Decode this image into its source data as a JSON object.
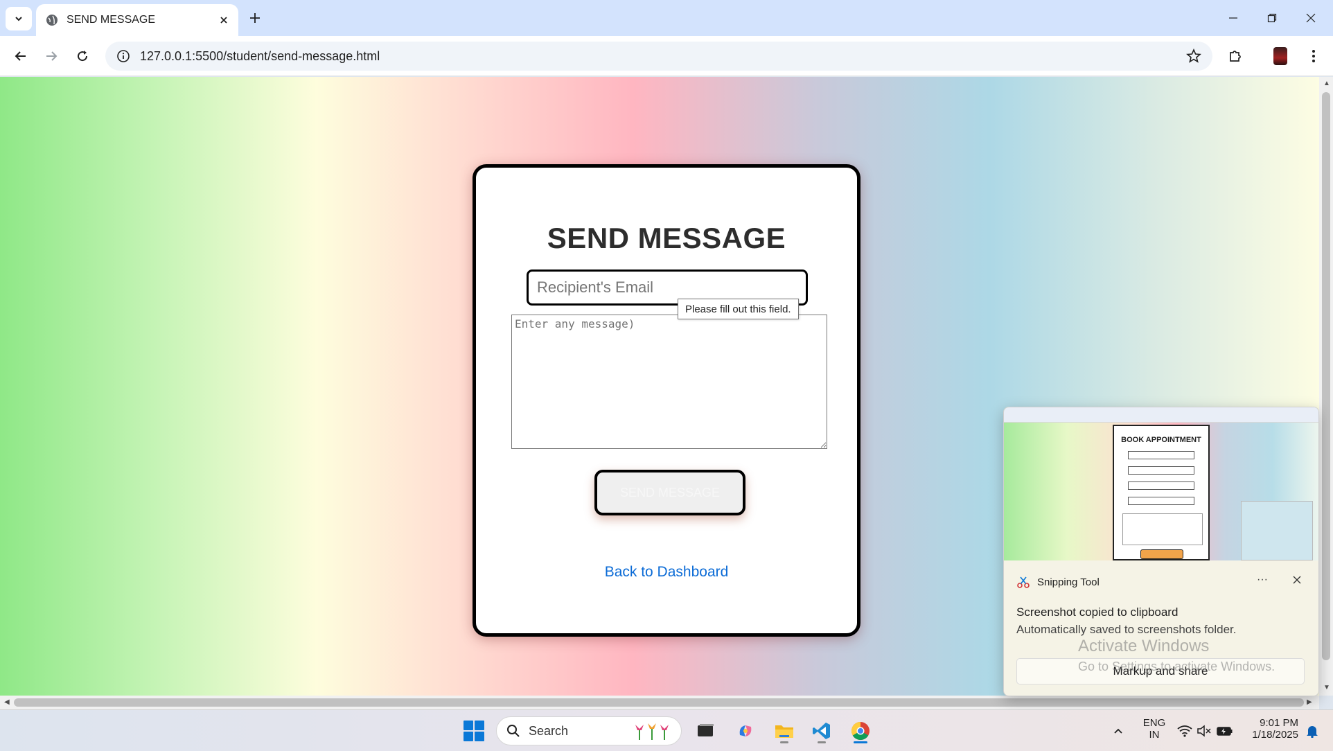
{
  "browser": {
    "tab_title": "SEND MESSAGE",
    "url": "127.0.0.1:5500/student/send-message.html"
  },
  "page": {
    "title": "SEND MESSAGE",
    "email_placeholder": "Recipient's Email",
    "validation_tooltip": "Please fill out this field.",
    "message_placeholder": "Enter any message)",
    "send_button": "SEND MESSAGE",
    "back_link": "Back to Dashboard"
  },
  "notification": {
    "app_name": "Snipping Tool",
    "more_label": "···",
    "heading": "Screenshot copied to clipboard",
    "subtext": "Automatically saved to screenshots folder.",
    "action_button": "Markup and share",
    "preview_title": "BOOK APPOINTMENT"
  },
  "watermark": {
    "line1": "Activate Windows",
    "line2": "Go to Settings to activate Windows."
  },
  "taskbar": {
    "search_label": "Search",
    "language": "ENG",
    "region": "IN",
    "time": "9:01 PM",
    "date": "1/18/2025"
  },
  "colors": {
    "accent": "#0a78d7",
    "link": "#0b6bd6",
    "tabbar": "#d3e3fd"
  }
}
